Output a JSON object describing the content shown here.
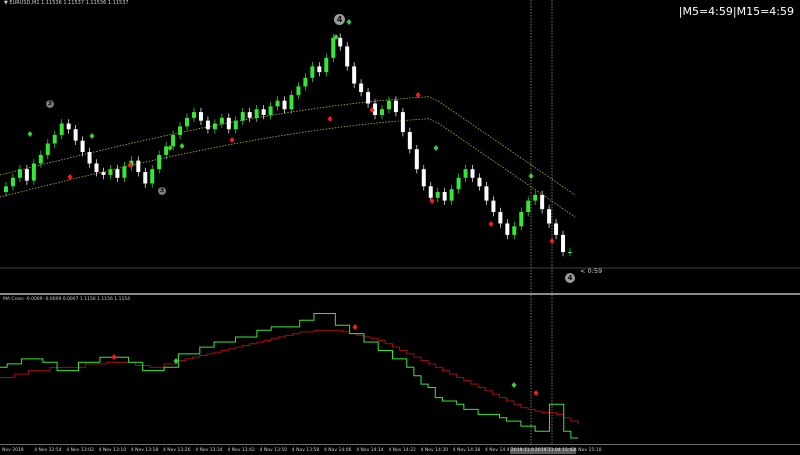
{
  "chart": {
    "symbol_info": "▼ EURUSD,M1  1.11536  1.11537  1.11536  1.11537",
    "timer_text": "|M5=4:59|M15=4:59",
    "countdown_tag": "< 0:59",
    "wave_labels": {
      "label_4_top": "4",
      "label_3_left_top": "3",
      "label_3_left_bottom": "3",
      "label_4_right": "4"
    },
    "colors": {
      "bull_candle": "#35e835",
      "bear_candle": "#ffffff",
      "envelope": "#c8b400",
      "buy_arrow": "#3ccf3c",
      "sell_arrow": "#ff1a1a",
      "hline": "#808080",
      "vline": "#c0c0c0"
    },
    "candle_closes": [
      1.1156,
      1.11563,
      1.11566,
      1.11562,
      1.11568,
      1.11571,
      1.11575,
      1.11578,
      1.11582,
      1.1158,
      1.11576,
      1.11572,
      1.11568,
      1.11565,
      1.11564,
      1.11566,
      1.11563,
      1.11567,
      1.11569,
      1.11565,
      1.11561,
      1.11566,
      1.11571,
      1.11574,
      1.11578,
      1.11581,
      1.11584,
      1.11586,
      1.11583,
      1.1158,
      1.11582,
      1.11584,
      1.1158,
      1.11583,
      1.11586,
      1.11584,
      1.11587,
      1.11585,
      1.11588,
      1.1159,
      1.11587,
      1.11592,
      1.11595,
      1.11598,
      1.11602,
      1.116,
      1.11605,
      1.11612,
      1.11609,
      1.11602,
      1.11596,
      1.11593,
      1.11589,
      1.11585,
      1.11587,
      1.1159,
      1.11586,
      1.11579,
      1.11573,
      1.11566,
      1.1156,
      1.11556,
      1.11558,
      1.11555,
      1.11559,
      1.11563,
      1.11566,
      1.11563,
      1.1156,
      1.11555,
      1.11551,
      1.11547,
      1.11543,
      1.11546,
      1.11551,
      1.11555,
      1.11557,
      1.11552,
      1.11547,
      1.11543,
      1.11537,
      1.11537
    ]
  },
  "indicator": {
    "label": "MA Cross  -0.0009  -0.0009  0.0007  1.1156  1.1156  1.1154",
    "fast_color": "#35e835",
    "slow_color": "#b01010",
    "fast": [
      0.3,
      0.32,
      0.32,
      0.35,
      0.35,
      0.35,
      0.33,
      0.33,
      0.28,
      0.28,
      0.28,
      0.33,
      0.33,
      0.33,
      0.36,
      0.36,
      0.36,
      0.36,
      0.33,
      0.33,
      0.28,
      0.28,
      0.28,
      0.3,
      0.3,
      0.38,
      0.38,
      0.38,
      0.42,
      0.42,
      0.45,
      0.45,
      0.45,
      0.48,
      0.48,
      0.48,
      0.52,
      0.52,
      0.54,
      0.54,
      0.54,
      0.54,
      0.58,
      0.58,
      0.62,
      0.62,
      0.62,
      0.55,
      0.55,
      0.5,
      0.5,
      0.45,
      0.45,
      0.4,
      0.4,
      0.35,
      0.35,
      0.3,
      0.25,
      0.2,
      0.18,
      0.12,
      0.1,
      0.1,
      0.08,
      0.05,
      0.05,
      0.02,
      0.02,
      0.02,
      0.0,
      -0.02,
      -0.02,
      -0.05,
      -0.05,
      -0.08,
      -0.08,
      0.08,
      0.08,
      -0.08,
      -0.12,
      -0.12
    ],
    "slow": [
      0.24,
      0.24,
      0.26,
      0.26,
      0.28,
      0.28,
      0.28,
      0.3,
      0.3,
      0.3,
      0.3,
      0.3,
      0.32,
      0.32,
      0.32,
      0.33,
      0.33,
      0.33,
      0.33,
      0.31,
      0.31,
      0.3,
      0.3,
      0.32,
      0.32,
      0.34,
      0.35,
      0.36,
      0.37,
      0.38,
      0.39,
      0.4,
      0.41,
      0.42,
      0.43,
      0.44,
      0.45,
      0.46,
      0.47,
      0.48,
      0.49,
      0.5,
      0.51,
      0.51,
      0.52,
      0.52,
      0.52,
      0.52,
      0.51,
      0.5,
      0.49,
      0.48,
      0.47,
      0.46,
      0.44,
      0.42,
      0.4,
      0.38,
      0.36,
      0.34,
      0.32,
      0.3,
      0.28,
      0.26,
      0.24,
      0.22,
      0.2,
      0.18,
      0.16,
      0.14,
      0.12,
      0.1,
      0.08,
      0.06,
      0.05,
      0.04,
      0.03,
      0.03,
      0.02,
      0.0,
      -0.02,
      -0.04
    ]
  },
  "time_axis": {
    "ticks": [
      "Nov 2019",
      "4 Nov 12:54",
      "4 Nov 13:02",
      "4 Nov 13:10",
      "4 Nov 13:18",
      "4 Nov 13:26",
      "4 Nov 13:34",
      "4 Nov 13:42",
      "4 Nov 13:50",
      "4 Nov 13:58",
      "4 Nov 14:06",
      "4 Nov 14:14",
      "4 Nov 14:22",
      "4 Nov 14:30",
      "4 Nov 14:38",
      "4 Nov 14:46"
    ],
    "highlight_1": "2019.11.04 14:54",
    "highlight_2": "2019.11.04 15:02",
    "last_tick": "4 Nov 15:10"
  }
}
